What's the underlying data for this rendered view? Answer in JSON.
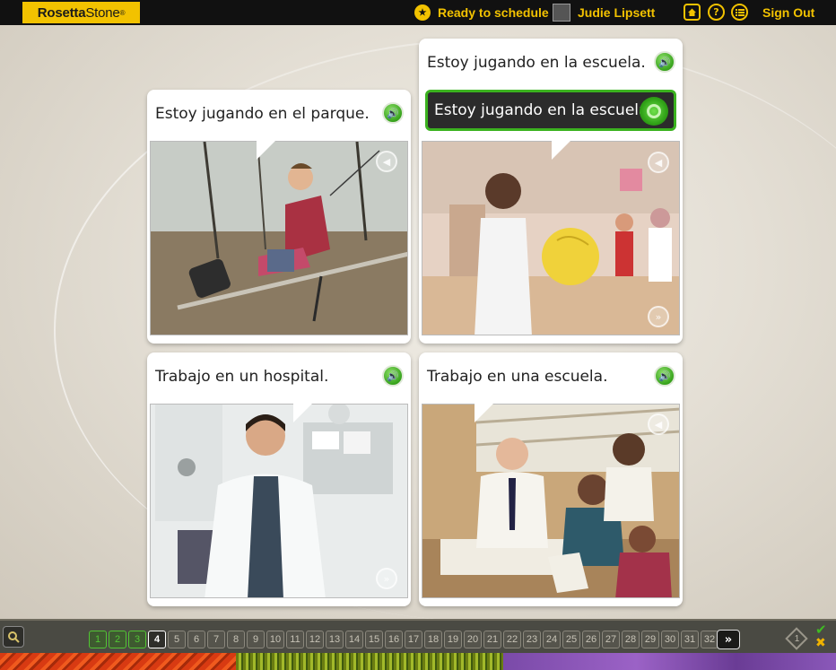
{
  "topbar": {
    "brand_bold": "Rosetta",
    "brand_light": "Stone",
    "brand_mark": "®",
    "schedule_label": "Ready to schedule",
    "user_name": "Judie Lipsett",
    "help_glyph": "?",
    "sign_out": "Sign Out",
    "accent_color": "#f2c200"
  },
  "cards": [
    {
      "caption": "Estoy jugando en el parque.",
      "scene": "boy on a swing in a park"
    },
    {
      "caption": "Estoy jugando en la escuela.",
      "answer": "Estoy jugando en la escuela.",
      "scene": "girl holding a yellow ball in a gym"
    },
    {
      "caption": "Trabajo en un hospital.",
      "scene": "doctor in white coat"
    },
    {
      "caption": "Trabajo en una escuela.",
      "scene": "teacher with students at a desk"
    }
  ],
  "pagination": {
    "pages": [
      "1",
      "2",
      "3",
      "4",
      "5",
      "6",
      "7",
      "8",
      "9",
      "10",
      "11",
      "12",
      "13",
      "14",
      "15",
      "16",
      "17",
      "18",
      "19",
      "20",
      "21",
      "22",
      "23",
      "24",
      "25",
      "26",
      "27",
      "28",
      "29",
      "30",
      "31",
      "32"
    ],
    "completed": 3,
    "current": "4",
    "next_glyph": "»",
    "attempt_number": "1",
    "check_glyph": "✔",
    "cross_glyph": "✖"
  },
  "icons": {
    "speaker": "speaker-icon",
    "zoom": "magnifier-icon",
    "home": "home-icon",
    "help": "help-icon",
    "menu": "list-icon"
  }
}
